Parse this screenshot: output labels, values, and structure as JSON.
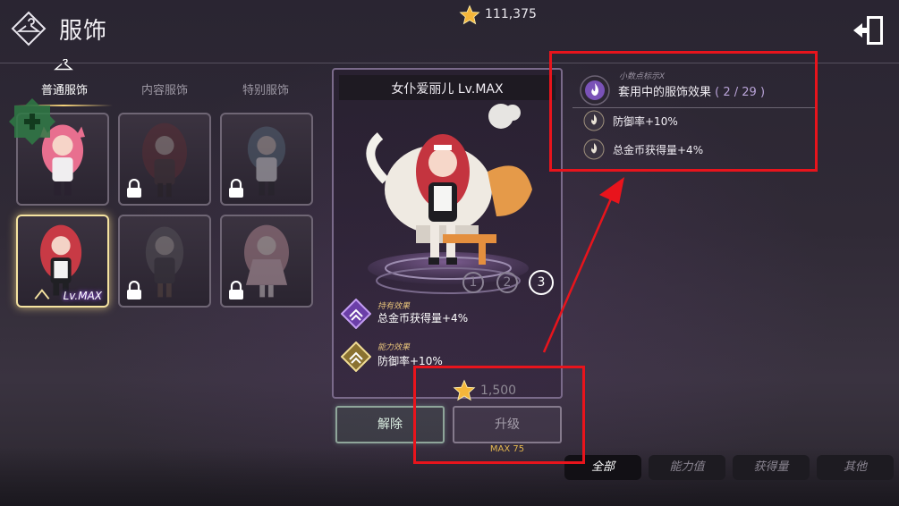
{
  "header": {
    "title": "服饰",
    "star_total": "111,375",
    "badge_icon": "hanger-icon",
    "exit_icon": "exit-door-icon"
  },
  "tabs": [
    {
      "label": "普通服饰",
      "active": true
    },
    {
      "label": "内容服饰",
      "active": false
    },
    {
      "label": "特别服饰",
      "active": false
    }
  ],
  "grid": {
    "cards": [
      {
        "id": "pink-girl",
        "locked": false,
        "selected": false
      },
      {
        "id": "red-hood",
        "locked": true,
        "selected": false
      },
      {
        "id": "blue-girl",
        "locked": true,
        "selected": false
      },
      {
        "id": "maid-alice",
        "locked": false,
        "selected": true,
        "level_label": "Lv.MAX"
      },
      {
        "id": "gray-girl",
        "locked": true,
        "selected": false
      },
      {
        "id": "pink-dress",
        "locked": true,
        "selected": false
      }
    ]
  },
  "detail": {
    "name": "女仆爱丽儿 Lv.MAX",
    "variants": [
      "1",
      "2",
      "3"
    ],
    "active_variant": "3",
    "effects": [
      {
        "title": "持有效果",
        "text": "总金币获得量+4%"
      },
      {
        "title": "能力效果",
        "text": "防御率+10%"
      }
    ],
    "cost": "1,500",
    "release_label": "解除",
    "upgrade_label": "升级",
    "max_label": "MAX 75"
  },
  "info": {
    "hint": "小数点标示X",
    "title": "套用中的服饰效果",
    "count": "( 2 / 29 )",
    "rows": [
      {
        "text": "防御率+10%"
      },
      {
        "text": "总金币获得量+4%"
      }
    ]
  },
  "filters": [
    {
      "label": "全部",
      "active": true
    },
    {
      "label": "能力值",
      "active": false
    },
    {
      "label": "获得量",
      "active": false
    },
    {
      "label": "其他",
      "active": false
    }
  ],
  "colors": {
    "accent_gold": "#f5e3a0",
    "annotation_red": "#e8141c",
    "effect_text": "#e6c27a"
  }
}
